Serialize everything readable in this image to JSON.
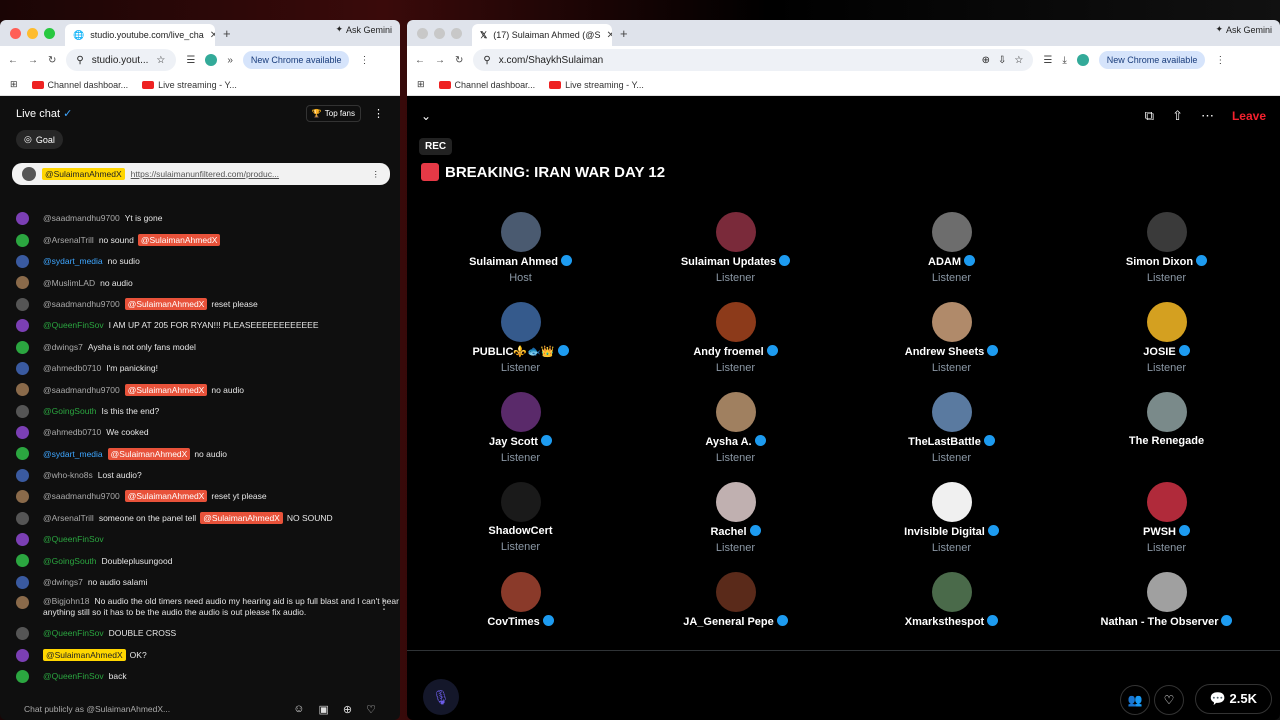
{
  "left": {
    "tab_title": "studio.youtube.com/live_cha",
    "ask_gemini": "Ask Gemini",
    "url": "studio.yout...",
    "new_chrome": "New Chrome available",
    "bookmarks": [
      "Channel dashboar...",
      "Live streaming - Y..."
    ],
    "live_chat": "Live chat",
    "top_fans": "Top fans",
    "goal": "Goal",
    "pinned_author": "@SulaimanAhmedX",
    "pinned_link": "https://sulaimanunfiltered.com/produc...",
    "messages": [
      {
        "author": "@saadmandhu9700",
        "text": "Yt is gone",
        "mention": ""
      },
      {
        "author": "@ArsenalTrill",
        "text": "no sound",
        "mention": "@SulaimanAhmedX"
      },
      {
        "author": "@sydart_media",
        "text": "no sudio",
        "mention": ""
      },
      {
        "author": "@MuslimLAD",
        "text": "no audio",
        "mention": ""
      },
      {
        "author": "@saadmandhu9700",
        "text": "reset please",
        "mention": "@SulaimanAhmedX"
      },
      {
        "author": "@QueenFinSov",
        "text": "I AM UP AT 205 FOR RYAN!!! PLEASEEEEEEEEEEEE",
        "mention": ""
      },
      {
        "author": "@dwings7",
        "text": "Aysha is not only fans model",
        "mention": ""
      },
      {
        "author": "@ahmedb0710",
        "text": "I'm panicking!",
        "mention": ""
      },
      {
        "author": "@saadmandhu9700",
        "text": "no audio",
        "mention": "@SulaimanAhmedX"
      },
      {
        "author": "@GoingSouth",
        "text": "Is this the end?",
        "mention": ""
      },
      {
        "author": "@ahmedb0710",
        "text": "We cooked",
        "mention": ""
      },
      {
        "author": "@sydart_media",
        "text": "no audio",
        "mention": "@SulaimanAhmedX"
      },
      {
        "author": "@who-kno8s",
        "text": "Lost audio?",
        "mention": ""
      },
      {
        "author": "@saadmandhu9700",
        "text": "reset yt please",
        "mention": "@SulaimanAhmedX"
      },
      {
        "author": "@ArsenalTrill",
        "text": "someone on the panel tell",
        "mention": "@SulaimanAhmedX",
        "after": "NO SOUND"
      },
      {
        "author": "@QueenFinSov",
        "text": "",
        "mention": ""
      },
      {
        "author": "@GoingSouth",
        "text": "Doubleplusungood",
        "mention": ""
      },
      {
        "author": "@dwings7",
        "text": "no audio salami",
        "mention": ""
      },
      {
        "author": "@Bigjohn18",
        "text": "No audio the old timers need audio my hearing aid is up full blast and I can't hear anything still so it has to be the audio the audio is out please fix audio.",
        "mention": ""
      },
      {
        "author": "@QueenFinSov",
        "text": "DOUBLE CROSS",
        "mention": ""
      },
      {
        "author": "@SulaimanAhmedX",
        "text": "OK?",
        "mention": ""
      },
      {
        "author": "@QueenFinSov",
        "text": "back",
        "mention": ""
      }
    ],
    "chat_placeholder": "Chat publicly as @SulaimanAhmedX..."
  },
  "right": {
    "tab_title": "(17) Sulaiman Ahmed (@S",
    "ask_gemini": "Ask Gemini",
    "url": "x.com/ShaykhSulaiman",
    "new_chrome": "New Chrome available",
    "bookmarks": [
      "Channel dashboar...",
      "Live streaming - Y..."
    ],
    "leave": "Leave",
    "rec": "REC",
    "title": "BREAKING: IRAN WAR DAY 12",
    "participants": [
      {
        "name": "Sulaiman Ahmed",
        "role": "Host",
        "color": "#4a5a70"
      },
      {
        "name": "Sulaiman Updates",
        "role": "Listener",
        "color": "#7a2a3a"
      },
      {
        "name": "ADAM",
        "role": "Listener",
        "color": "#6d6d6d"
      },
      {
        "name": "Simon Dixon",
        "role": "Listener",
        "color": "#3a3a3a"
      },
      {
        "name": "PUBLIC⚜️🐟👑",
        "role": "Listener",
        "color": "#355a8c"
      },
      {
        "name": "Andy froemel",
        "role": "Listener",
        "color": "#8c3a1a"
      },
      {
        "name": "Andrew Sheets",
        "role": "Listener",
        "color": "#b08a6a"
      },
      {
        "name": "JOSIE",
        "role": "Listener",
        "color": "#d4a020"
      },
      {
        "name": "Jay Scott",
        "role": "Listener",
        "color": "#5a2a6a"
      },
      {
        "name": "Aysha A.",
        "role": "Listener",
        "color": "#a08060"
      },
      {
        "name": "TheLastBattle",
        "role": "Listener",
        "color": "#5a7aa0"
      },
      {
        "name": "The Renegade",
        "role": "",
        "color": "#7a8a8a"
      },
      {
        "name": "ShadowCert",
        "role": "Listener",
        "color": "#1a1a1a"
      },
      {
        "name": "Rachel",
        "role": "Listener",
        "color": "#c0b0b0"
      },
      {
        "name": "Invisible Digital",
        "role": "Listener",
        "color": "#f0f0f0"
      },
      {
        "name": "PWSH",
        "role": "Listener",
        "color": "#b02a3a"
      },
      {
        "name": "CovTimes",
        "role": "",
        "color": "#8a3a2a"
      },
      {
        "name": "JA_General Pepe",
        "role": "",
        "color": "#5a2a1a"
      },
      {
        "name": "Xmarksthespot",
        "role": "",
        "color": "#4a6a4a"
      },
      {
        "name": "Nathan - The Observer",
        "role": "",
        "color": "#a0a0a0"
      }
    ],
    "listener_count": "2.5K"
  }
}
